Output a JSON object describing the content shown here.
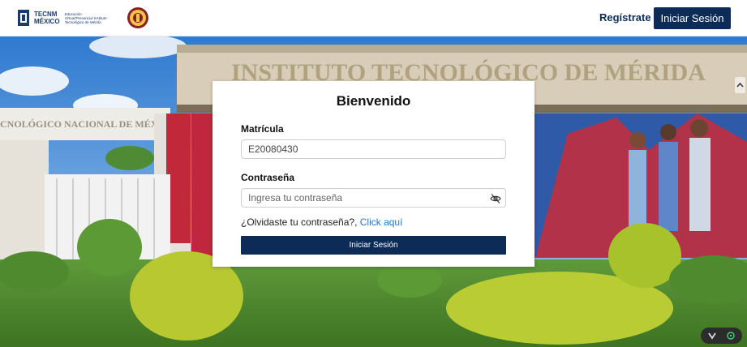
{
  "header": {
    "logo_brand": "TECNM",
    "logo_brand_sub": "MÉXICO",
    "logo_tagline": "Educación Virtual/Presencial Instituto Tecnológico de Mérida",
    "register_label": "Regístrate",
    "login_label": "Iniciar Sesión"
  },
  "hero": {
    "building_sign": "INSTITUTO TECNOLÓGICO DE MÉRIDA",
    "gate_sign": "CNOLÓGICO NACIONAL DE MÉXICO"
  },
  "login_card": {
    "title": "Bienvenido",
    "matricula_label": "Matrícula",
    "matricula_value": "E20080430",
    "password_label": "Contraseña",
    "password_placeholder": "Ingresa tu contraseña",
    "forgot_text": "¿Olvidaste tu contraseña?, ",
    "forgot_link": "Click aquí",
    "submit_label": "Iniciar Sesión"
  },
  "icons": {
    "eye": "eye-slash-icon",
    "widget_left": "chevron-down-icon",
    "widget_right": "target-icon",
    "side": "chevron-up-icon"
  },
  "colors": {
    "primary": "#0c2b57",
    "link": "#1e77c9"
  }
}
